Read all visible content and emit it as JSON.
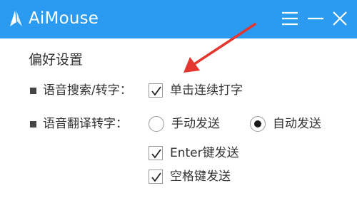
{
  "window": {
    "title": "AiMouse",
    "icons": {
      "logo": "aimouse-logo-icon",
      "menu": "hamburger-menu-icon",
      "minimize": "minimize-icon",
      "close": "close-icon"
    },
    "colors": {
      "titlebar": "#2a9bf0",
      "arrow": "#e3362e"
    }
  },
  "settings": {
    "section_title": "偏好设置",
    "voice_search": {
      "label": "语音搜索/转字：",
      "option": {
        "label": "单击连续打字",
        "checked": true
      }
    },
    "voice_translate": {
      "label": "语音翻译转字：",
      "radio_options": [
        {
          "label": "手动发送",
          "selected": false
        },
        {
          "label": "自动发送",
          "selected": true
        }
      ],
      "checkboxes": [
        {
          "label": "Enter键发送",
          "checked": true
        },
        {
          "label": "空格键发送",
          "checked": true
        }
      ]
    }
  },
  "annotation": {
    "icon": "red-arrow-icon",
    "points_to": "单击连续打字"
  }
}
